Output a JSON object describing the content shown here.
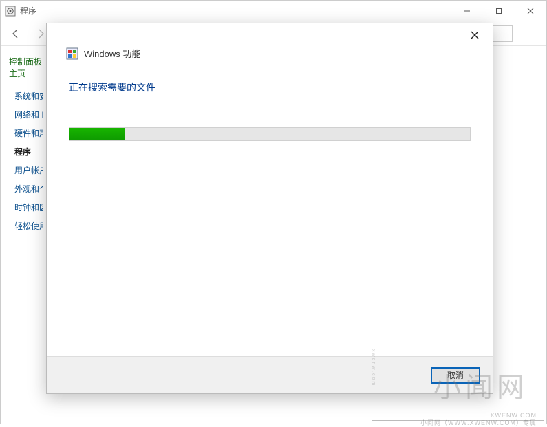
{
  "parent_window": {
    "title": "程序",
    "sidebar": {
      "home": "控制面板主页",
      "items": [
        {
          "label": "系统和安全",
          "current": false
        },
        {
          "label": "网络和 Internet",
          "current": false
        },
        {
          "label": "硬件和声音",
          "current": false
        },
        {
          "label": "程序",
          "current": true
        },
        {
          "label": "用户帐户",
          "current": false
        },
        {
          "label": "外观和个性化",
          "current": false
        },
        {
          "label": "时钟和区域",
          "current": false
        },
        {
          "label": "轻松使用",
          "current": false
        }
      ]
    }
  },
  "dialog": {
    "title": "Windows 功能",
    "status": "正在搜索需要的文件",
    "progress_percent": 14,
    "cancel_label": "取消"
  },
  "watermark": {
    "big": "小闻网",
    "url": "XWENW.COM",
    "side": "xwenw.com",
    "footer": "小闻网（WWW.XWENW.COM）专属"
  }
}
